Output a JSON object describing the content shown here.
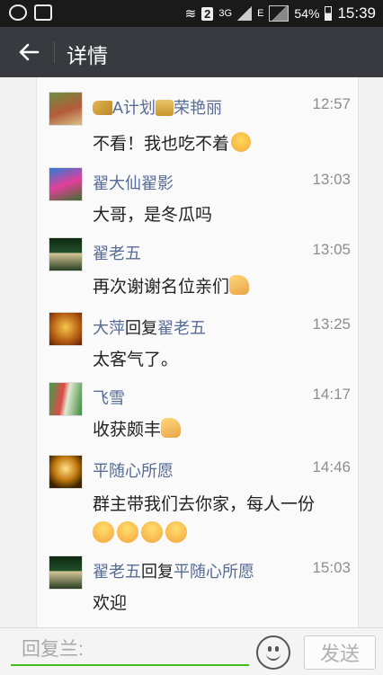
{
  "status_bar": {
    "network_badge": "2",
    "network_type": "3G",
    "roaming": "E",
    "battery": "54%",
    "time": "15:39",
    "icons": [
      "q-app-icon",
      "image-icon",
      "wifi-icon",
      "signal-icon",
      "battery-icon"
    ]
  },
  "header": {
    "title": "详情",
    "back_icon": "arrow-left-icon",
    "background_color": "#393a3f"
  },
  "messages": [
    {
      "name": "A计划",
      "name_suffix": "荣艳丽",
      "time": "12:57",
      "text": "不看！我也吃不着",
      "emoji": "laughing-face"
    },
    {
      "name": "翟大仙翟影",
      "time": "13:03",
      "text": "大哥，是冬瓜吗"
    },
    {
      "name": "翟老五",
      "time": "13:05",
      "text": "再次谢谢名位亲们",
      "emoji": "pointing-hand"
    },
    {
      "name": "大萍",
      "reply_word": "回复",
      "reply_to": "翟老五",
      "time": "13:25",
      "text": "太客气了。"
    },
    {
      "name": "飞雪",
      "time": "14:17",
      "text": "收获颇丰",
      "emoji": "thumbs-up"
    },
    {
      "name": "平随心所愿",
      "time": "14:46",
      "text": "群主带我们去你家，每人一份",
      "emoji": "grinning-face x4"
    },
    {
      "name": "翟老五",
      "reply_word": "回复",
      "reply_to": "平随心所愿",
      "time": "15:03",
      "text": "欢迎"
    }
  ],
  "composer": {
    "placeholder": "回复兰:",
    "send_label": "发送",
    "emoji_button_icon": "smiley-icon",
    "accent_color": "#45c01a"
  }
}
